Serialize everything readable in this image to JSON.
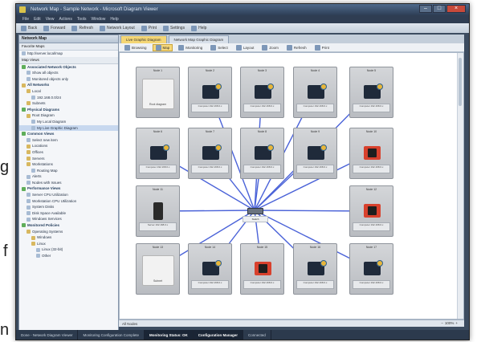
{
  "outside_text": {
    "left_top": "g",
    "left_mid": "f",
    "left_bottom": "n"
  },
  "window": {
    "title": "Network Map - Sample Network - Microsoft Diagram Viewer"
  },
  "menubar": [
    "File",
    "Edit",
    "View",
    "Actions",
    "Tools",
    "Window",
    "Help"
  ],
  "toolbar": [
    "Back",
    "Forward",
    "Refresh",
    "Network Layout",
    "Print",
    "Settings",
    "Help"
  ],
  "left_pane": {
    "title": "Network Map",
    "section_favorites": "Favorite Maps",
    "favorites": [
      {
        "label": "http://server.local/map",
        "icon": "blank"
      }
    ],
    "section_maps": "Map Views",
    "tree": [
      {
        "label": "Associated Network Objects",
        "icon": "green",
        "hdr": true
      },
      {
        "label": "Show all objects",
        "icon": "blank",
        "indent": 1
      },
      {
        "label": "Monitored objects only",
        "icon": "blank",
        "indent": 1
      },
      {
        "label": "All Networks",
        "icon": "folder",
        "hdr": true
      },
      {
        "label": "Local",
        "icon": "folder",
        "indent": 1
      },
      {
        "label": "192.168.0.0/24",
        "icon": "blank",
        "indent": 2
      },
      {
        "label": "Subnets",
        "icon": "folder",
        "indent": 1
      },
      {
        "label": "Physical Diagrams",
        "icon": "green",
        "hdr": true
      },
      {
        "label": "Root Diagram",
        "icon": "folder",
        "indent": 1
      },
      {
        "label": "My Local Diagram",
        "icon": "blank",
        "indent": 2
      },
      {
        "label": "My Live Graphic Diagram",
        "icon": "blank",
        "indent": 2,
        "sel": true
      },
      {
        "label": "Common Views",
        "icon": "green",
        "hdr": true
      },
      {
        "label": "Select new item",
        "icon": "blank",
        "indent": 1
      },
      {
        "label": "Locations",
        "icon": "folder",
        "indent": 1
      },
      {
        "label": "Offices",
        "icon": "folder",
        "indent": 1
      },
      {
        "label": "Servers",
        "icon": "folder",
        "indent": 1
      },
      {
        "label": "Workstations",
        "icon": "folder",
        "indent": 1
      },
      {
        "label": "Routing Map",
        "icon": "blank",
        "indent": 2
      },
      {
        "label": "Alerts",
        "icon": "blank",
        "indent": 1
      },
      {
        "label": "Nodes with Issues",
        "icon": "blank",
        "indent": 1
      },
      {
        "label": "Performance Views",
        "icon": "green",
        "hdr": true
      },
      {
        "label": "Server CPU Utilization",
        "icon": "blank",
        "indent": 1
      },
      {
        "label": "Workstation CPU Utilization",
        "icon": "blank",
        "indent": 1
      },
      {
        "label": "System Disks",
        "icon": "blank",
        "indent": 1
      },
      {
        "label": "Disk Space Available",
        "icon": "blank",
        "indent": 1
      },
      {
        "label": "Windows Services",
        "icon": "blank",
        "indent": 1
      },
      {
        "label": "Monitored Policies",
        "icon": "green",
        "hdr": true
      },
      {
        "label": "Operating Systems",
        "icon": "folder",
        "indent": 1
      },
      {
        "label": "Windows",
        "icon": "folder",
        "indent": 2
      },
      {
        "label": "Linux",
        "icon": "folder",
        "indent": 2
      },
      {
        "label": "Linux (32-bit)",
        "icon": "blank",
        "indent": 3
      },
      {
        "label": "Other",
        "icon": "blank",
        "indent": 3
      }
    ]
  },
  "doc_tabs": [
    {
      "label": "Live Graphic Diagram",
      "active": true
    },
    {
      "label": "Network Map Graphic Diagram",
      "active": false
    }
  ],
  "doc_toolbar": [
    "Browsing",
    "Map",
    "Monitoring",
    "Select",
    "Layout",
    "Zoom",
    "Refresh",
    "Print"
  ],
  "doc_toolbar_active": "Map",
  "nodes": [
    {
      "title": "Node 1",
      "icon": "blank",
      "label": "Root diagram",
      "plain": true
    },
    {
      "title": "Node 2",
      "icon": "comp",
      "label": "Computer  192.168.0.x"
    },
    {
      "title": "Node 3",
      "icon": "comp",
      "label": "Computer  192.168.0.x"
    },
    {
      "title": "Node 4",
      "icon": "comp",
      "label": "Computer  192.168.0.x"
    },
    {
      "title": "Node 5",
      "icon": "comp",
      "label": "Computer  192.168.0.x"
    },
    {
      "title": "Node 6",
      "icon": "comp",
      "label": "Computer  192.168.0.x"
    },
    {
      "title": "Node 7",
      "icon": "comp",
      "label": "Computer  192.168.0.x"
    },
    {
      "title": "Node 8",
      "icon": "comp",
      "label": "Computer  192.168.0.x"
    },
    {
      "title": "Node 9",
      "icon": "comp",
      "label": "Computer  192.168.0.x"
    },
    {
      "title": "Node 10",
      "icon": "alert",
      "label": "Computer  192.168.0.x"
    },
    {
      "title": "Node 11",
      "icon": "tower",
      "label": "Server  192.168.0.x"
    },
    {
      "title": "Node 12",
      "icon": "alert",
      "label": "Computer  192.168.0.x"
    },
    {
      "title": "Node 13",
      "icon": "blank",
      "label": "Subnet",
      "plain": true
    },
    {
      "title": "Node 14",
      "icon": "comp",
      "label": "Computer  192.168.0.x"
    },
    {
      "title": "Node 15",
      "icon": "alert",
      "label": "Computer  192.168.0.x"
    },
    {
      "title": "Node 16",
      "icon": "comp",
      "label": "Computer  192.168.0.x"
    },
    {
      "title": "Node 17",
      "icon": "comp",
      "label": "Computer  192.168.0.x"
    }
  ],
  "hub": {
    "label": "Switch"
  },
  "canvas_status": "All Nodes",
  "zoom": {
    "value": "100%"
  },
  "status_bar": [
    {
      "label": "Done - Network Diagram Viewer",
      "hl": false
    },
    {
      "label": "Monitoring  Configuration  Complete",
      "hl": false
    },
    {
      "label": "Monitoring Status: OK",
      "hl": true
    },
    {
      "label": "Configuration Manager",
      "hl": true
    },
    {
      "label": "Connected",
      "hl": false
    }
  ],
  "colors": {
    "link": "#4a62d8",
    "accent": "#f4d675"
  }
}
